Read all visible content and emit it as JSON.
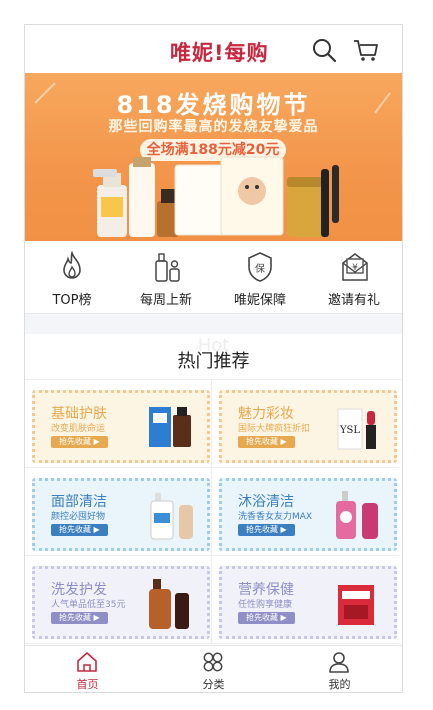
{
  "header": {
    "logo_text": "唯妮!每购",
    "search_icon": "search-icon",
    "cart_icon": "cart-icon"
  },
  "banner": {
    "title": "818发烧购物节",
    "subtitle": "那些回购率最高的发烧友挚爱品",
    "promo": "全场满188元减20元"
  },
  "quick_links": [
    {
      "label": "TOP榜",
      "icon": "flame-icon"
    },
    {
      "label": "每周上新",
      "icon": "bottles-icon"
    },
    {
      "label": "唯妮保障",
      "icon": "shield-icon"
    },
    {
      "label": "邀请有礼",
      "icon": "envelope-icon"
    }
  ],
  "hot": {
    "ghost": "Hot",
    "title": "热门推荐"
  },
  "categories": [
    {
      "title": "基础护肤",
      "subtitle": "改变肌肤命运",
      "button": "抢先收藏 ▶",
      "theme": "#f6c88f",
      "bg": "#fdf5e4",
      "text": "#e6a94f"
    },
    {
      "title": "魅力彩妆",
      "subtitle": "国际大牌疯狂折扣",
      "button": "抢先收藏 ▶",
      "theme": "#f6c88f",
      "bg": "#fdf5e4",
      "text": "#e6a94f"
    },
    {
      "title": "面部清洁",
      "subtitle": "颜控必囤好物",
      "button": "抢先收藏 ▶",
      "theme": "#9fcde8",
      "bg": "#eaf4fb",
      "text": "#3b7fc0"
    },
    {
      "title": "沐浴清洁",
      "subtitle": "洗香香女友力MAX",
      "button": "抢先收藏 ▶",
      "theme": "#9fcde8",
      "bg": "#eaf4fb",
      "text": "#3b7fc0"
    },
    {
      "title": "洗发护发",
      "subtitle": "人气单品低至35元",
      "button": "抢先收藏 ▶",
      "theme": "#c7c8e6",
      "bg": "#f1f1fa",
      "text": "#8d8fc6"
    },
    {
      "title": "营养保健",
      "subtitle": "任性购享健康",
      "button": "抢先收藏 ▶",
      "theme": "#c7c8e6",
      "bg": "#f1f1fa",
      "text": "#8d8fc6"
    }
  ],
  "tabbar": [
    {
      "label": "首页",
      "icon": "home-icon",
      "active": true
    },
    {
      "label": "分类",
      "icon": "category-icon",
      "active": false
    },
    {
      "label": "我的",
      "icon": "user-icon",
      "active": false
    }
  ],
  "colors": {
    "brand": "#c7283f",
    "banner": "#f3954a"
  }
}
